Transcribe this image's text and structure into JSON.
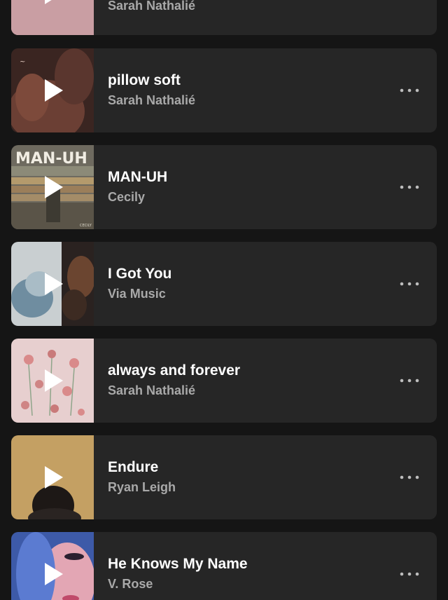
{
  "tracks": [
    {
      "title": "",
      "artist": "Sarah Nathalié"
    },
    {
      "title": "pillow soft",
      "artist": "Sarah Nathalié"
    },
    {
      "title": "MAN-UH",
      "artist": "Cecily",
      "art_text": "MAN-UH",
      "art_small_text": "CECILY"
    },
    {
      "title": "I Got You",
      "artist": "Via Music"
    },
    {
      "title": "always and forever",
      "artist": "Sarah Nathalié"
    },
    {
      "title": "Endure",
      "artist": "Ryan Leigh"
    },
    {
      "title": "He Knows My Name",
      "artist": "V. Rose"
    }
  ],
  "icons": {
    "play": "play-icon",
    "more": "more-options-icon"
  },
  "colors": {
    "background": "#151515",
    "card": "#262626",
    "title": "#ffffff",
    "artist": "#a9a9a9"
  }
}
